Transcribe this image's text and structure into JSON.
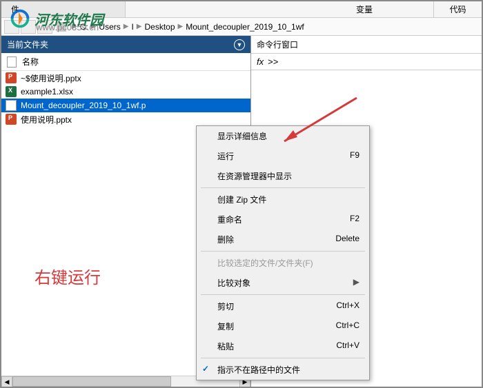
{
  "watermark": {
    "text": "河东软件园",
    "url": "www.pc0359.cn"
  },
  "tabs": {
    "file": "件",
    "var": "变量",
    "code": "代码"
  },
  "breadcrumb": {
    "drive": "C:",
    "parts": [
      "Users",
      "I",
      "Desktop",
      "Mount_decoupler_2019_10_1wf"
    ]
  },
  "left_panel": {
    "title": "当前文件夹",
    "column": "名称",
    "files": [
      {
        "name": "~$使用说明.pptx",
        "type": "ppt"
      },
      {
        "name": "example1.xlsx",
        "type": "xlsx"
      },
      {
        "name": "Mount_decoupler_2019_10_1wf.p",
        "type": "wf",
        "selected": true
      },
      {
        "name": "使用说明.pptx",
        "type": "ppt"
      }
    ]
  },
  "right_panel": {
    "title": "命令行窗口",
    "fx": "fx",
    "fx_prompt": ">>"
  },
  "annotation": "右键运行",
  "context_menu": {
    "items": [
      {
        "label": "显示详细信息",
        "shortcut": ""
      },
      {
        "label": "运行",
        "shortcut": "F9"
      },
      {
        "label": "在资源管理器中显示",
        "shortcut": ""
      },
      {
        "sep": true
      },
      {
        "label": "创建 Zip 文件",
        "shortcut": ""
      },
      {
        "label": "重命名",
        "shortcut": "F2"
      },
      {
        "label": "删除",
        "shortcut": "Delete"
      },
      {
        "sep": true
      },
      {
        "label": "比较选定的文件/文件夹(F)",
        "shortcut": "",
        "disabled": true
      },
      {
        "label": "比较对象",
        "shortcut": "",
        "submenu": true
      },
      {
        "sep": true
      },
      {
        "label": "剪切",
        "shortcut": "Ctrl+X"
      },
      {
        "label": "复制",
        "shortcut": "Ctrl+C"
      },
      {
        "label": "粘贴",
        "shortcut": "Ctrl+V"
      },
      {
        "sep": true
      },
      {
        "label": "指示不在路径中的文件",
        "shortcut": "",
        "checked": true
      }
    ]
  }
}
